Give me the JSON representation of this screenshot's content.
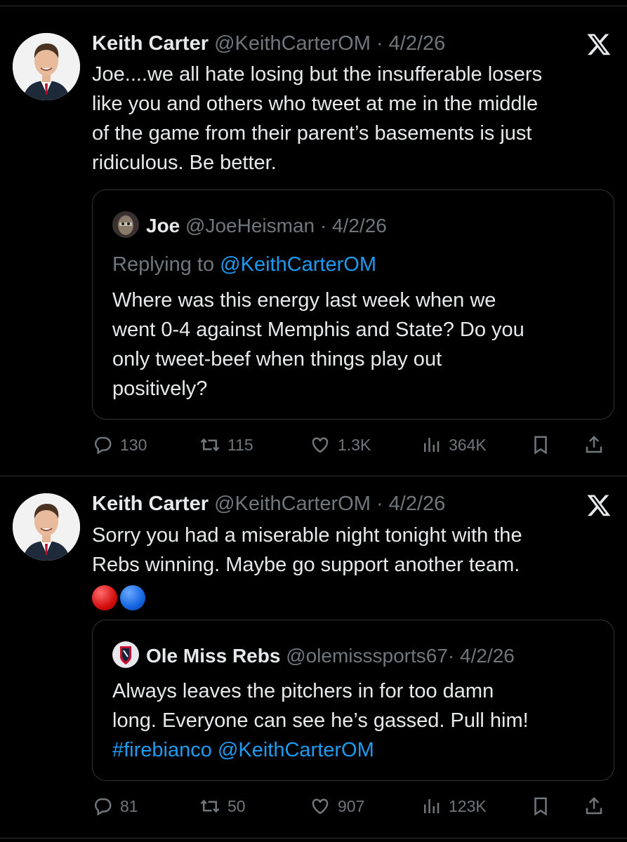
{
  "tweets": [
    {
      "author_name": "Keith Carter",
      "author_handle": "@KeithCarterOM",
      "separator": " · ",
      "date": "4/2/26",
      "text_lines": [
        "Joe....we all hate losing but the insufferable losers",
        "like you and others who tweet at me in the middle",
        "of the game from their parent’s basements is just",
        "ridiculous. Be better."
      ],
      "quote": {
        "author_name": "Joe",
        "author_handle": "@JoeHeisman",
        "separator": " · ",
        "date": "4/2/26",
        "replying_prefix": "Replying to ",
        "replying_handle": "@KeithCarterOM",
        "text_lines": [
          "Where was this energy last week when we",
          "went 0-4 against Memphis and State?  Do you",
          "only tweet-beef when things play out",
          "positively?"
        ]
      },
      "stats": {
        "replies": "130",
        "retweets": "115",
        "likes": "1.3K",
        "views": "364K"
      }
    },
    {
      "author_name": "Keith Carter",
      "author_handle": "@KeithCarterOM",
      "separator": " · ",
      "date": "4/2/26",
      "text_lines": [
        "Sorry you had a miserable night tonight with the",
        "Rebs winning. Maybe go support another team."
      ],
      "emojis": [
        "red-circle",
        "blue-circle"
      ],
      "quote": {
        "author_name": "Ole Miss Rebs",
        "author_handle": "@olemisssports67",
        "separator": "· ",
        "date": "4/2/26",
        "text_lines": [
          "Always leaves the pitchers in for too damn",
          "long. Everyone can see he’s gassed. Pull him!"
        ],
        "hashtag": "#firebianco",
        "mention": "@KeithCarterOM"
      },
      "stats": {
        "replies": "81",
        "retweets": "50",
        "likes": "907",
        "views": "123K"
      }
    }
  ],
  "colors": {
    "background": "#000000",
    "text": "#e7e9ea",
    "muted": "#71767b",
    "link": "#1d9bf0",
    "border": "#2f3336"
  },
  "icons": [
    "x-logo-icon",
    "reply-icon",
    "retweet-icon",
    "like-icon",
    "views-icon",
    "bookmark-icon",
    "share-icon"
  ]
}
